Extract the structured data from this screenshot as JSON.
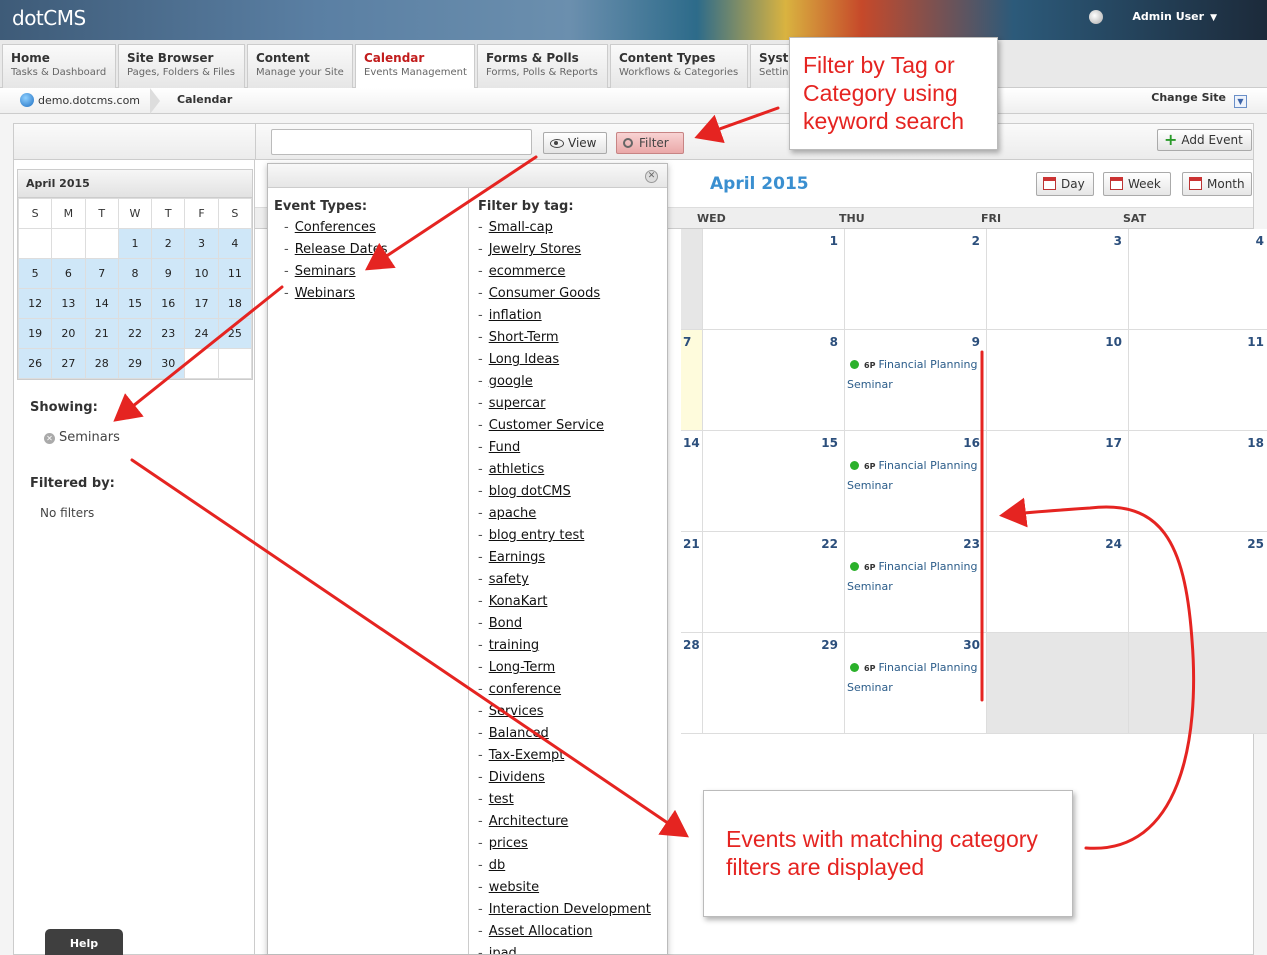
{
  "app": {
    "logo": "dotCMS",
    "user": "Admin User"
  },
  "nav": [
    {
      "title": "Home",
      "sub": "Tasks & Dashboard"
    },
    {
      "title": "Site Browser",
      "sub": "Pages, Folders & Files"
    },
    {
      "title": "Content",
      "sub": "Manage your Site"
    },
    {
      "title": "Calendar",
      "sub": "Events Management"
    },
    {
      "title": "Forms & Polls",
      "sub": "Forms, Polls & Reports"
    },
    {
      "title": "Content Types",
      "sub": "Workflows & Categories"
    },
    {
      "title": "Syst",
      "sub": "Settin"
    }
  ],
  "breadcrumb": {
    "site": "demo.dotcms.com",
    "current": "Calendar",
    "change_site": "Change Site"
  },
  "toolbar": {
    "search_value": "",
    "view_label": "View",
    "filter_label": "Filter",
    "add_label": "Add Event"
  },
  "mini_calendar": {
    "title": "April 2015",
    "weekdays": [
      "S",
      "M",
      "T",
      "W",
      "T",
      "F",
      "S"
    ],
    "weeks": [
      [
        "",
        "",
        "",
        "1",
        "2",
        "3",
        "4"
      ],
      [
        "5",
        "6",
        "7",
        "8",
        "9",
        "10",
        "11"
      ],
      [
        "12",
        "13",
        "14",
        "15",
        "16",
        "17",
        "18"
      ],
      [
        "19",
        "20",
        "21",
        "22",
        "23",
        "24",
        "25"
      ],
      [
        "26",
        "27",
        "28",
        "29",
        "30",
        "",
        ""
      ]
    ]
  },
  "sidebar": {
    "showing_label": "Showing:",
    "showing_item": "Seminars",
    "filtered_label": "Filtered by:",
    "no_filters": "No filters"
  },
  "calendar": {
    "title": "April 2015",
    "views": [
      "Day",
      "Week",
      "Month"
    ],
    "day_headers": [
      "WED",
      "THU",
      "FRI",
      "SAT"
    ],
    "rows": [
      [
        "1",
        "2",
        "3",
        "4"
      ],
      [
        "8",
        "9",
        "10",
        "11"
      ],
      [
        "15",
        "16",
        "17",
        "18"
      ],
      [
        "22",
        "23",
        "24",
        "25"
      ],
      [
        "29",
        "30",
        "",
        ""
      ]
    ],
    "left_col_nums": [
      "",
      "7",
      "14",
      "21",
      "28"
    ],
    "event": {
      "time": "6P",
      "title": "Financial Planning Seminar"
    }
  },
  "filter_popup": {
    "event_types_label": "Event Types:",
    "event_types": [
      "Conferences",
      "Release Dates",
      "Seminars",
      "Webinars"
    ],
    "tags_label": "Filter by tag:",
    "tags": [
      "Small-cap",
      "Jewelry Stores",
      "ecommerce",
      "Consumer Goods",
      "inflation",
      "Short-Term",
      "Long Ideas",
      "google",
      "supercar",
      "Customer Service",
      "Fund",
      "athletics",
      "blog dotCMS",
      "apache",
      "blog entry test",
      "Earnings",
      "safety",
      "KonaKart",
      "Bond",
      "training",
      "Long-Term",
      "conference",
      "Services",
      "Balanced",
      "Tax-Exempt",
      "Dividens",
      "test",
      "Architecture",
      "prices",
      "db",
      "website",
      "Interaction Development",
      "Asset Allocation",
      "ipad"
    ]
  },
  "help_label": "Help",
  "annotations": {
    "top": "Filter by Tag or Category using keyword search",
    "bottom": "Events with matching category filters are displayed",
    "color": "#e52421"
  }
}
